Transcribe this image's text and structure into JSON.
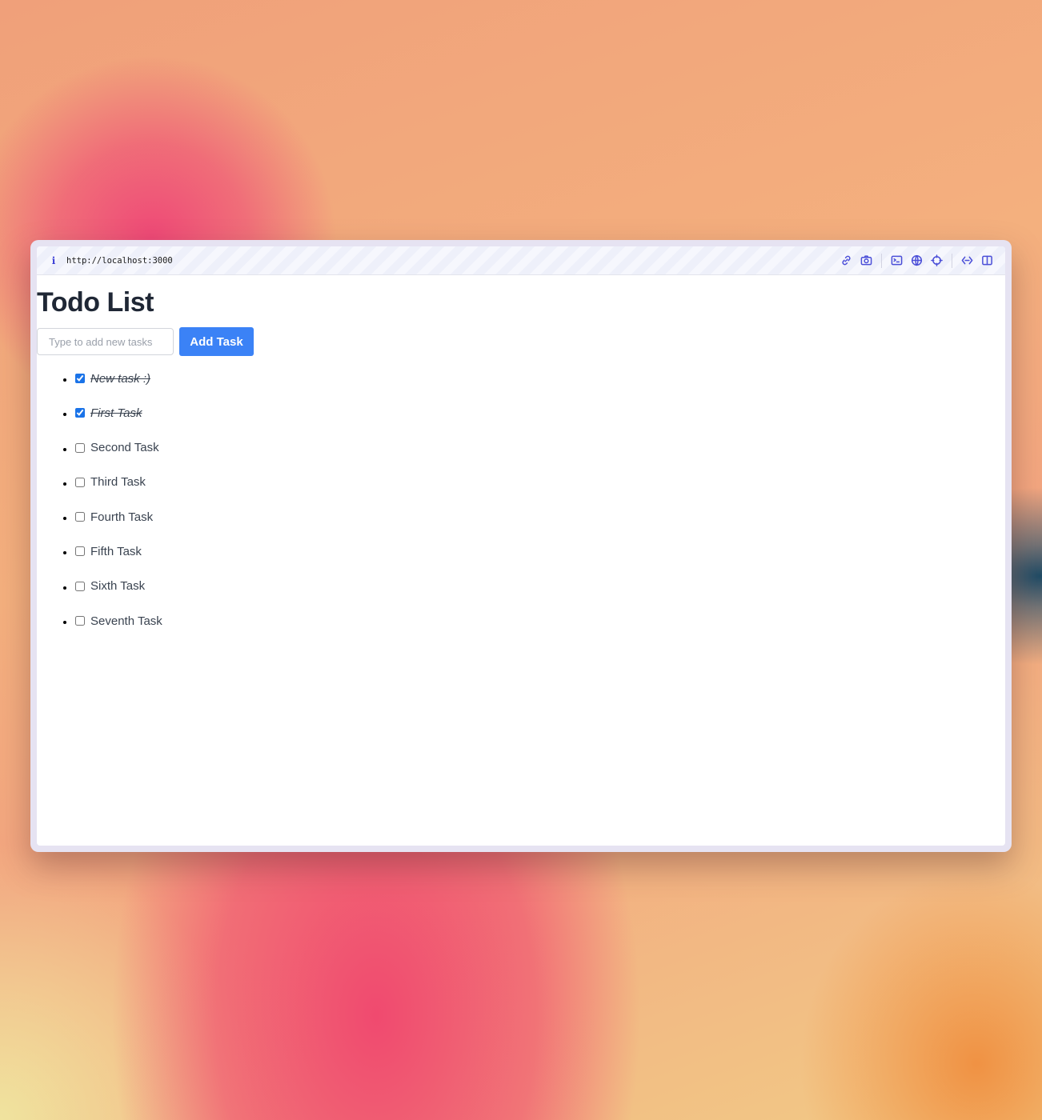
{
  "browser": {
    "url": "http://localhost:3000",
    "toolbar_icons": [
      "link-icon",
      "camera-icon",
      "terminal-icon",
      "globe-icon",
      "crosshair-icon",
      "code-icon",
      "split-view-icon"
    ]
  },
  "page": {
    "title": "Todo List",
    "input_placeholder": "Type to add new tasks",
    "input_value": "",
    "add_button_label": "Add Task"
  },
  "tasks": [
    {
      "label": "New task :)",
      "done": true
    },
    {
      "label": "First Task",
      "done": true
    },
    {
      "label": "Second Task",
      "done": false
    },
    {
      "label": "Third Task",
      "done": false
    },
    {
      "label": "Fourth Task",
      "done": false
    },
    {
      "label": "Fifth Task",
      "done": false
    },
    {
      "label": "Sixth Task",
      "done": false
    },
    {
      "label": "Seventh Task",
      "done": false
    }
  ],
  "colors": {
    "accent": "#3b82f6",
    "toolbar_icon": "#4b4fd8",
    "title": "#1f2735"
  }
}
